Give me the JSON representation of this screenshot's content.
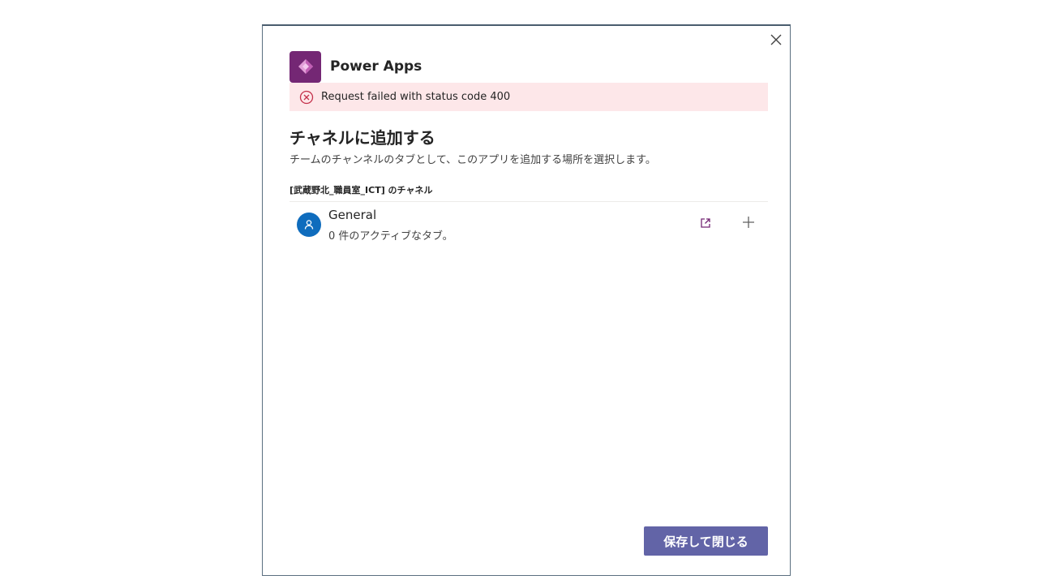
{
  "dialog": {
    "close_icon": "close-icon",
    "app": {
      "name": "Power Apps",
      "logo_icon": "power-apps-logo-icon",
      "logo_color": "#742774"
    },
    "error": {
      "icon": "error-circle-icon",
      "message": "Request failed with status code 400",
      "background": "#fde7e9",
      "icon_color": "#c4314b"
    },
    "title": "チャネルに追加する",
    "subtitle": "チームのチャンネルのタブとして、このアプリを追加する場所を選択します。",
    "team_label": "[武蔵野北_職員室_ICT] のチャネル",
    "channels": [
      {
        "name": "General",
        "status": "0 件のアクティブなタブ。",
        "avatar_icon": "channel-person-icon",
        "avatar_color": "#0f6cbd",
        "open_icon": "open-external-icon",
        "add_icon": "add-icon"
      }
    ],
    "save_button": {
      "label": "保存して閉じる",
      "color": "#6264a7"
    }
  }
}
